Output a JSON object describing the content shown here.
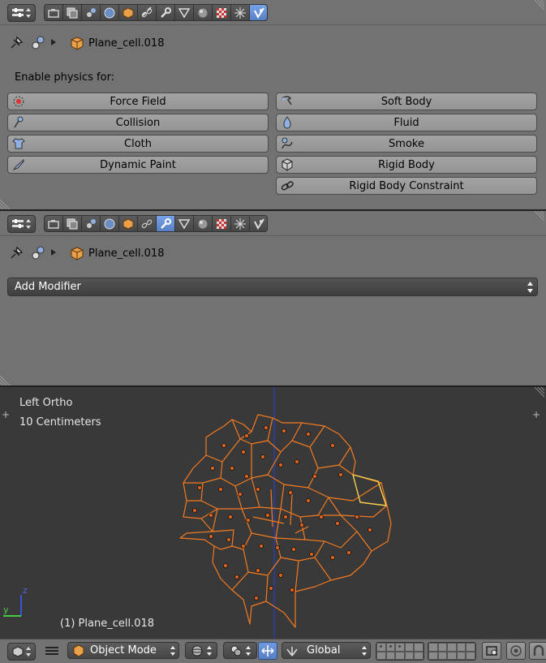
{
  "physics": {
    "object_name": "Plane_cell.018",
    "enable_label": "Enable physics for:",
    "buttons_left": [
      "Force Field",
      "Collision",
      "Cloth",
      "Dynamic Paint"
    ],
    "buttons_right": [
      "Soft Body",
      "Fluid",
      "Smoke",
      "Rigid Body",
      "Rigid Body Constraint"
    ],
    "active_tab": "physics-tab"
  },
  "modifiers": {
    "object_name": "Plane_cell.018",
    "add_modifier_label": "Add Modifier",
    "active_tab": "modifiers-tab"
  },
  "viewport": {
    "view_name": "Left Ortho",
    "scale_label": "10 Centimeters",
    "object_label": "(1) Plane_cell.018",
    "axis_z": "z",
    "axis_y": "y"
  },
  "bottom_bar": {
    "mode": "Object Mode",
    "orientation": "Global"
  },
  "colors": {
    "panel_bg": "#727272",
    "viewport_bg": "#393939",
    "selection_orange": "#f47a1f",
    "active_blue": "#5680c2"
  }
}
